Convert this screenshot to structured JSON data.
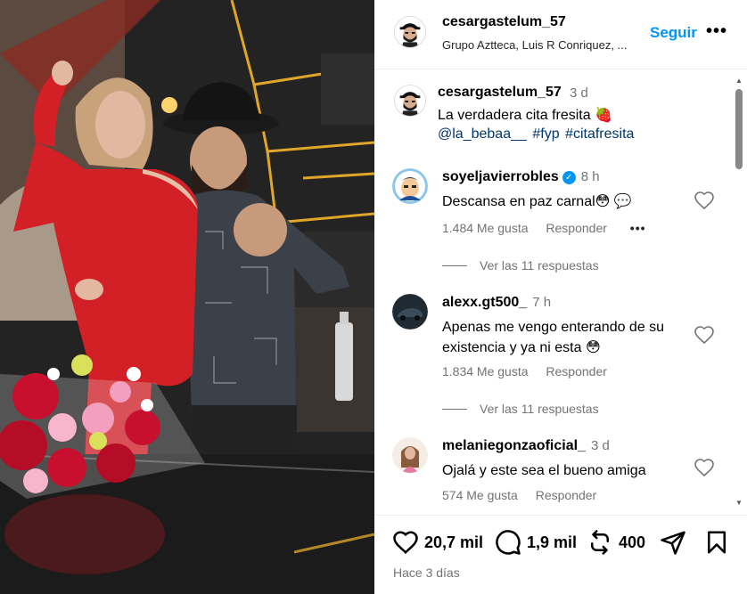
{
  "post": {
    "username": "cesargastelum_57",
    "subtitle": "Grupo Aztteca, Luis R Conriquez, ...",
    "follow_label": "Seguir",
    "more_label": "•••",
    "photo_alt_icons": [
      "bouquet-icon",
      "cowboy-hat-icon"
    ]
  },
  "caption": {
    "username": "cesargastelum_57",
    "time": "3 d",
    "text": "La verdadera cita fresita 🍓",
    "tags": [
      "@la_bebaa__",
      "#fyp",
      "#citafresita"
    ]
  },
  "comments": [
    {
      "username": "soyeljavierrobles",
      "verified": true,
      "time": "8 h",
      "text": "Descansa en paz carnal😳 💬",
      "likes": "1.484 Me gusta",
      "reply_label": "Responder",
      "more_label": "•••",
      "replies": "Ver las 11 respuestas"
    },
    {
      "username": "alexx.gt500_",
      "verified": false,
      "time": "7 h",
      "text": "Apenas me vengo enterando de su existencia y ya ni esta 😳",
      "likes": "1.834 Me gusta",
      "reply_label": "Responder",
      "replies": "Ver las 11 respuestas"
    },
    {
      "username": "melaniegonzaoficial_",
      "verified": false,
      "time": "3 d",
      "text": "Ojalá y este sea el bueno amiga",
      "likes": "574 Me gusta",
      "reply_label": "Responder"
    }
  ],
  "actions": {
    "likes": "20,7 mil",
    "comments": "1,9 mil",
    "reposts": "400",
    "timestamp": "Hace 3 días"
  },
  "colors": {
    "accent": "#0095f6",
    "link": "#00376b",
    "muted": "#737373",
    "dress_red": "#d31f26"
  }
}
